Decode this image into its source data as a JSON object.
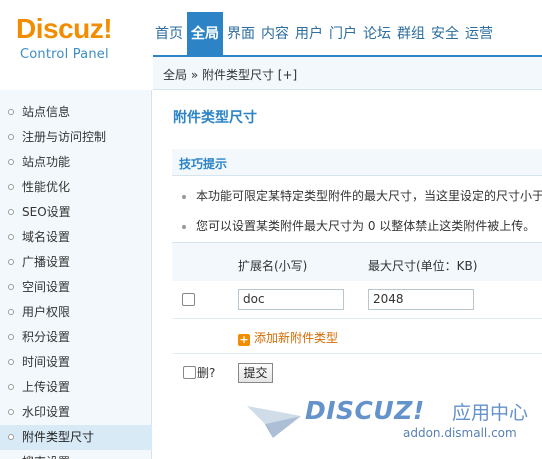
{
  "logo": {
    "main": "Discuz!",
    "sub": "Control Panel"
  },
  "nav": {
    "items": [
      "首页",
      "全局",
      "界面",
      "内容",
      "用户",
      "门户",
      "论坛",
      "群组",
      "安全",
      "运营"
    ],
    "active_index": 1
  },
  "breadcrumb": {
    "text": "全局 » 附件类型尺寸  [+]"
  },
  "sidebar": {
    "items": [
      "站点信息",
      "注册与访问控制",
      "站点功能",
      "性能优化",
      "SEO设置",
      "域名设置",
      "广播设置",
      "空间设置",
      "用户权限",
      "积分设置",
      "时间设置",
      "上传设置",
      "水印设置",
      "附件类型尺寸",
      "搜索设置"
    ],
    "active_index": 13
  },
  "main": {
    "title": "附件类型尺寸",
    "tips_title": "技巧提示",
    "tips": [
      "本功能可限定某特定类型附件的最大尺寸，当这里设定的尺寸小于",
      "您可以设置某类附件最大尺寸为 0 以整体禁止这类附件被上传。"
    ],
    "columns": {
      "ext": "扩展名(小写)",
      "max_size": "最大尺寸(单位：KB)"
    },
    "row": {
      "ext": "doc",
      "max_size": "2048"
    },
    "add_link": "添加新附件类型",
    "delete_label": "删?",
    "submit_label": "提交"
  },
  "watermark": {
    "brand": "DISCUZ!",
    "cn": "应用中心",
    "url": "addon.dismall.com"
  }
}
